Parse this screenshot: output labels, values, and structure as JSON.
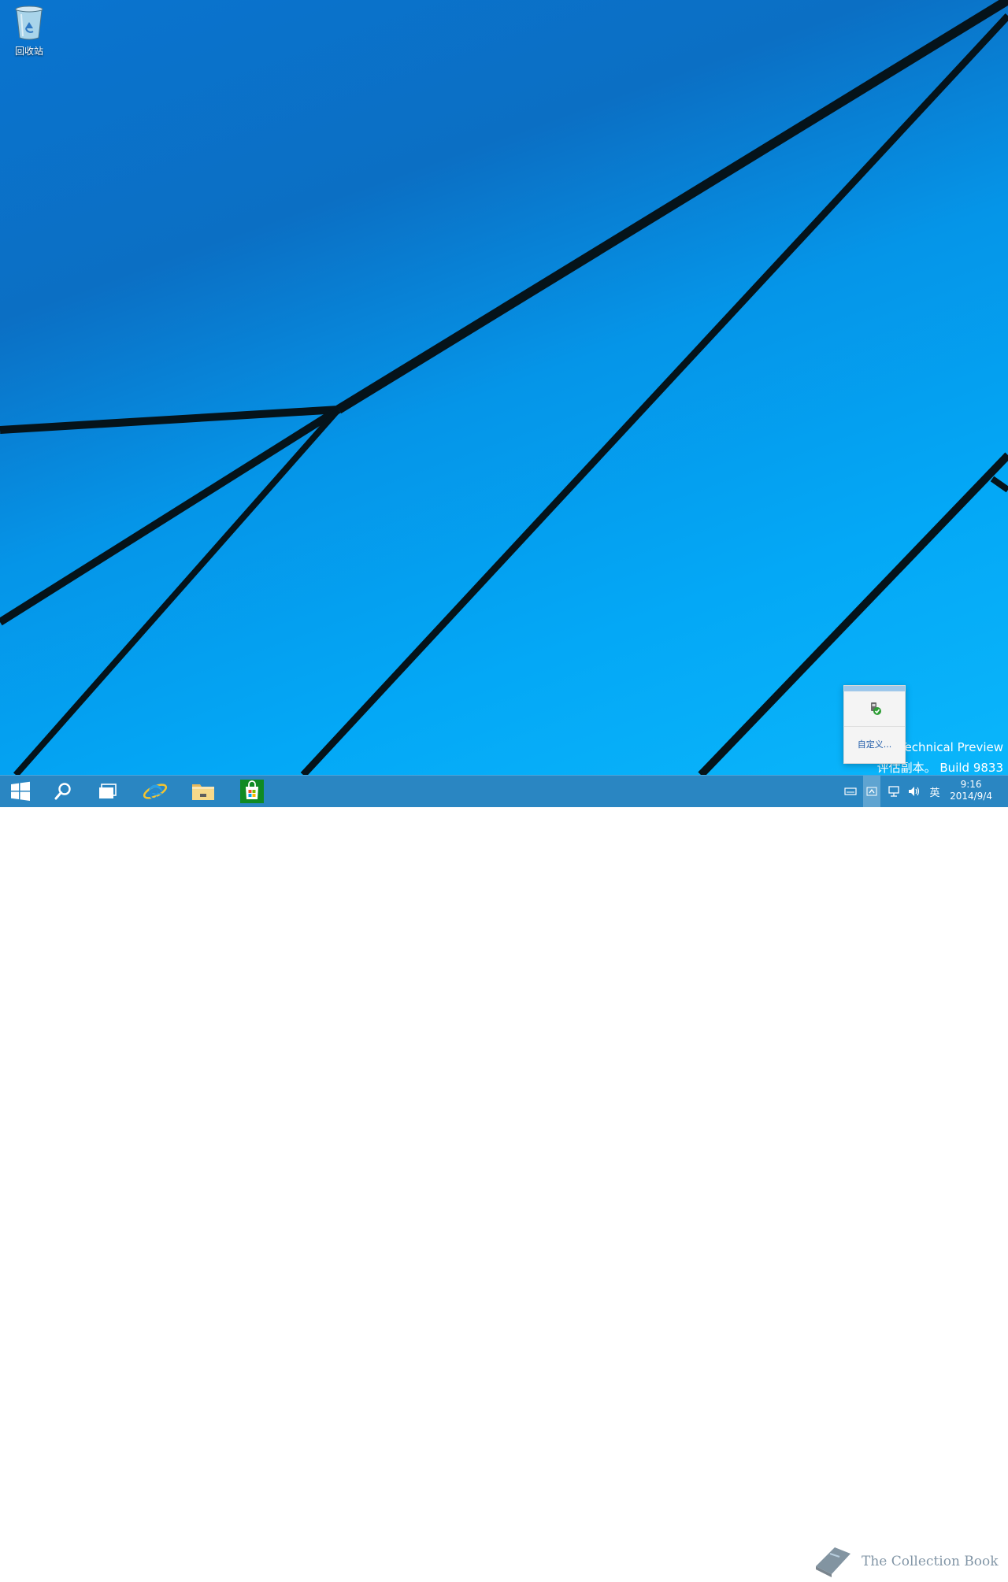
{
  "desktop": {
    "recycle_bin_label": "回收站"
  },
  "watermark": {
    "line1": "Technical Preview",
    "line2": "评估副本。 Build 9833"
  },
  "tray_popup": {
    "customize_label": "自定义..."
  },
  "taskbar": {
    "items": [
      {
        "name": "start-button",
        "icon": "windows-logo-icon"
      },
      {
        "name": "search-button",
        "icon": "search-icon"
      },
      {
        "name": "task-view-button",
        "icon": "task-view-icon"
      },
      {
        "name": "internet-explorer-button",
        "icon": "ie-icon"
      },
      {
        "name": "file-explorer-button",
        "icon": "folder-icon"
      },
      {
        "name": "store-button",
        "icon": "store-icon"
      }
    ],
    "ime_label": "英",
    "time": "9:16",
    "date": "2014/9/4",
    "overlay_text": "The Collection Book"
  },
  "colors": {
    "taskbar": "#2a86c2",
    "wallpaper_light": "#0ab6fb",
    "wallpaper_dark": "#0b6fc4",
    "store_green": "#0f8a23"
  }
}
